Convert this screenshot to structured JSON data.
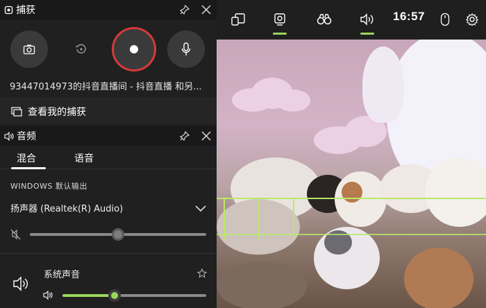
{
  "capture": {
    "title": "捕获",
    "stream_title": "93447014973的抖音直播间 - 抖音直播 和另...",
    "view_captures": "查看我的捕获"
  },
  "audio": {
    "title": "音频",
    "tabs": [
      {
        "label": "混合",
        "active": true
      },
      {
        "label": "语音",
        "active": false
      }
    ],
    "output_label": "WINDOWS 默认输出",
    "device": "扬声器 (Realtek(R) Audio)",
    "master_volume": 0.5,
    "system_sound": {
      "label": "系统声音",
      "volume": 0.36
    }
  },
  "gamebar": {
    "clock": "16:57"
  },
  "colors": {
    "record_ring": "#d63a3a",
    "accent_green": "#9bd65b"
  },
  "icons": {
    "screenshot": "camera-icon",
    "record_last": "replay-icon",
    "record": "record-dot-icon",
    "mic": "microphone-icon",
    "pin": "pin-icon",
    "close": "close-icon",
    "widgets": "widget-icon",
    "capture": "capture-icon",
    "performance": "binoculars-icon",
    "audio": "speaker-icon",
    "mouse": "mouse-icon",
    "settings": "gear-icon"
  }
}
